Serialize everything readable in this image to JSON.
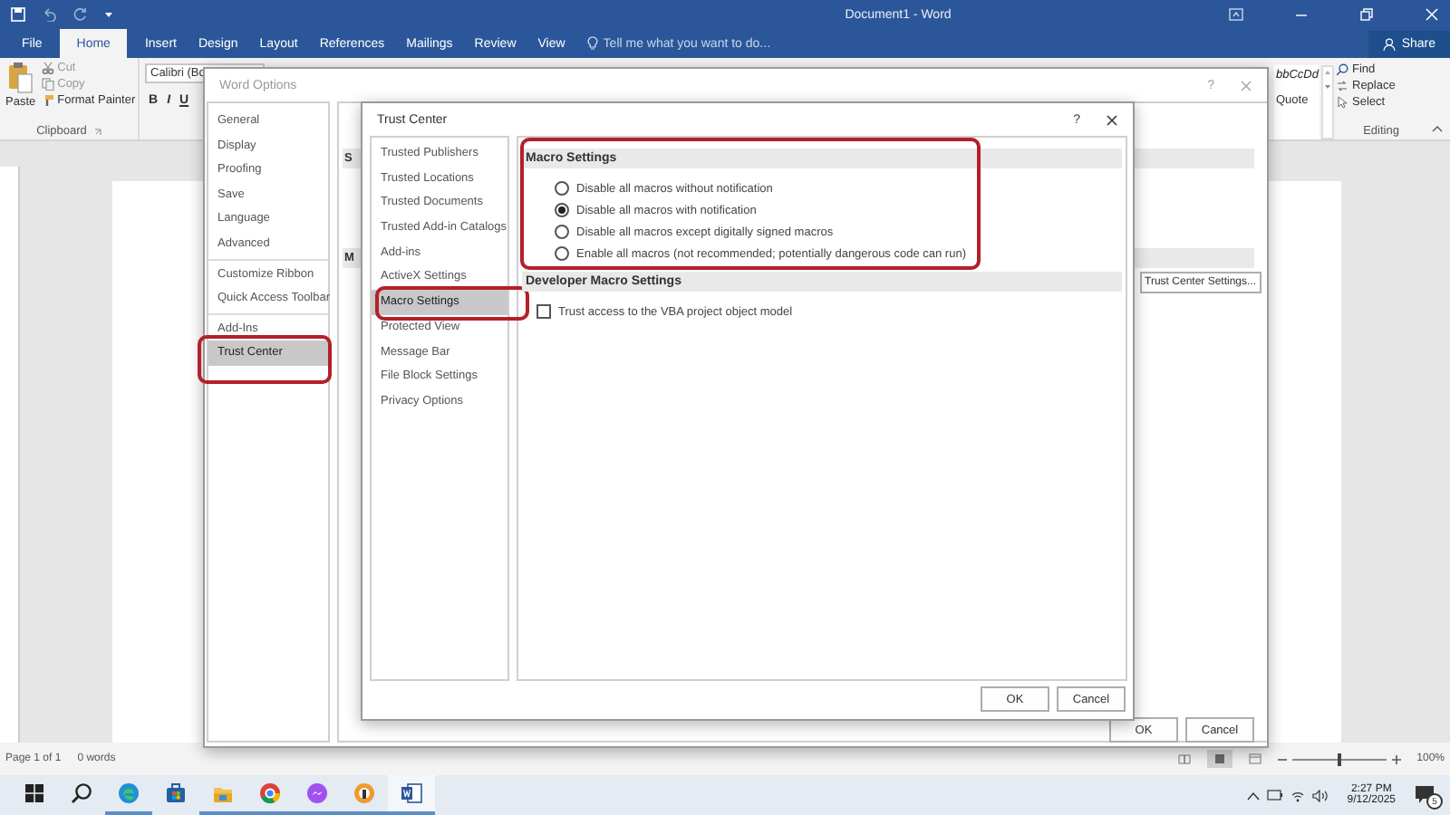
{
  "window": {
    "title": "Document1 - Word"
  },
  "ribbon_tabs": [
    {
      "label": "File",
      "selected": false
    },
    {
      "label": "Home",
      "selected": true
    },
    {
      "label": "Insert",
      "selected": false
    },
    {
      "label": "Design",
      "selected": false
    },
    {
      "label": "Layout",
      "selected": false
    },
    {
      "label": "References",
      "selected": false
    },
    {
      "label": "Mailings",
      "selected": false
    },
    {
      "label": "Review",
      "selected": false
    },
    {
      "label": "View",
      "selected": false
    }
  ],
  "tell_me": {
    "placeholder": "Tell me what you want to do..."
  },
  "share": "Share",
  "clipboard": {
    "paste": "Paste",
    "commands": [
      "Cut",
      "Copy",
      "Format Painter"
    ],
    "label": "Clipboard"
  },
  "font": {
    "name": "Calibri (Bo",
    "buttons": [
      "B",
      "I",
      "U"
    ]
  },
  "styles": {
    "preview": "bbCcDd",
    "name": "Quote"
  },
  "editing": {
    "commands": [
      "Find",
      "Replace",
      "Select"
    ],
    "label": "Editing"
  },
  "word_options": {
    "title": "Word Options",
    "help": "?",
    "nav_groups": [
      {
        "items": [
          {
            "label": "General",
            "selected": false,
            "highlighted": false
          },
          {
            "label": "Display",
            "selected": false,
            "highlighted": false
          },
          {
            "label": "Proofing",
            "selected": false,
            "highlighted": false
          },
          {
            "label": "Save",
            "selected": false,
            "highlighted": false
          },
          {
            "label": "Language",
            "selected": false,
            "highlighted": false
          },
          {
            "label": "Advanced",
            "selected": false,
            "highlighted": false
          }
        ]
      },
      {
        "items": [
          {
            "label": "Customize Ribbon",
            "selected": false,
            "highlighted": false
          },
          {
            "label": "Quick Access Toolbar",
            "selected": false,
            "highlighted": false
          }
        ]
      },
      {
        "items": [
          {
            "label": "Add-Ins",
            "selected": false,
            "highlighted": false
          },
          {
            "label": "Trust Center",
            "selected": true,
            "highlighted": true
          }
        ]
      }
    ],
    "section_headings": [
      "S",
      "M"
    ],
    "settings_button": "Trust Center Settings...",
    "buttons": [
      "OK",
      "Cancel"
    ]
  },
  "trust_center": {
    "title": "Trust Center",
    "help": "?",
    "nav": [
      {
        "label": "Trusted Publishers",
        "selected": false,
        "highlighted": false
      },
      {
        "label": "Trusted Locations",
        "selected": false,
        "highlighted": false
      },
      {
        "label": "Trusted Documents",
        "selected": false,
        "highlighted": false
      },
      {
        "label": "Trusted Add-in Catalogs",
        "selected": false,
        "highlighted": false
      },
      {
        "label": "Add-ins",
        "selected": false,
        "highlighted": false
      },
      {
        "label": "ActiveX Settings",
        "selected": false,
        "highlighted": false
      },
      {
        "label": "Macro Settings",
        "selected": true,
        "highlighted": true
      },
      {
        "label": "Protected View",
        "selected": false,
        "highlighted": false
      },
      {
        "label": "Message Bar",
        "selected": false,
        "highlighted": false
      },
      {
        "label": "File Block Settings",
        "selected": false,
        "highlighted": false
      },
      {
        "label": "Privacy Options",
        "selected": false,
        "highlighted": false
      }
    ],
    "sections": [
      {
        "heading": "Macro Settings",
        "highlighted": true,
        "options": [
          {
            "kind": "radio",
            "label": "Disable all macros without notification",
            "selected": false
          },
          {
            "kind": "radio",
            "label": "Disable all macros with notification",
            "selected": true
          },
          {
            "kind": "radio",
            "label": "Disable all macros except digitally signed macros",
            "selected": false
          },
          {
            "kind": "radio",
            "label": "Enable all macros (not recommended; potentially dangerous code can run)",
            "selected": false
          }
        ]
      },
      {
        "heading": "Developer Macro Settings",
        "highlighted": false,
        "options": [
          {
            "kind": "checkbox",
            "label": "Trust access to the VBA project object model",
            "checked": false
          }
        ]
      }
    ],
    "buttons": [
      "OK",
      "Cancel"
    ]
  },
  "status_bar": {
    "page": "Page 1 of 1",
    "words": "0 words",
    "zoom_slider": {
      "level": 0.5
    },
    "zoom": "100%"
  },
  "taskbar": {
    "apps": [
      {
        "kind": "edge",
        "running": true,
        "active": false
      },
      {
        "kind": "store",
        "running": false,
        "active": false
      },
      {
        "kind": "explorer",
        "running": true,
        "active": false
      },
      {
        "kind": "chrome",
        "running": true,
        "active": false
      },
      {
        "kind": "messenger",
        "running": true,
        "active": false
      },
      {
        "kind": "app",
        "running": true,
        "active": false
      },
      {
        "kind": "word",
        "running": true,
        "active": true
      }
    ],
    "time": "2:27 PM",
    "date": "9/12/2025",
    "notifications": "5"
  }
}
